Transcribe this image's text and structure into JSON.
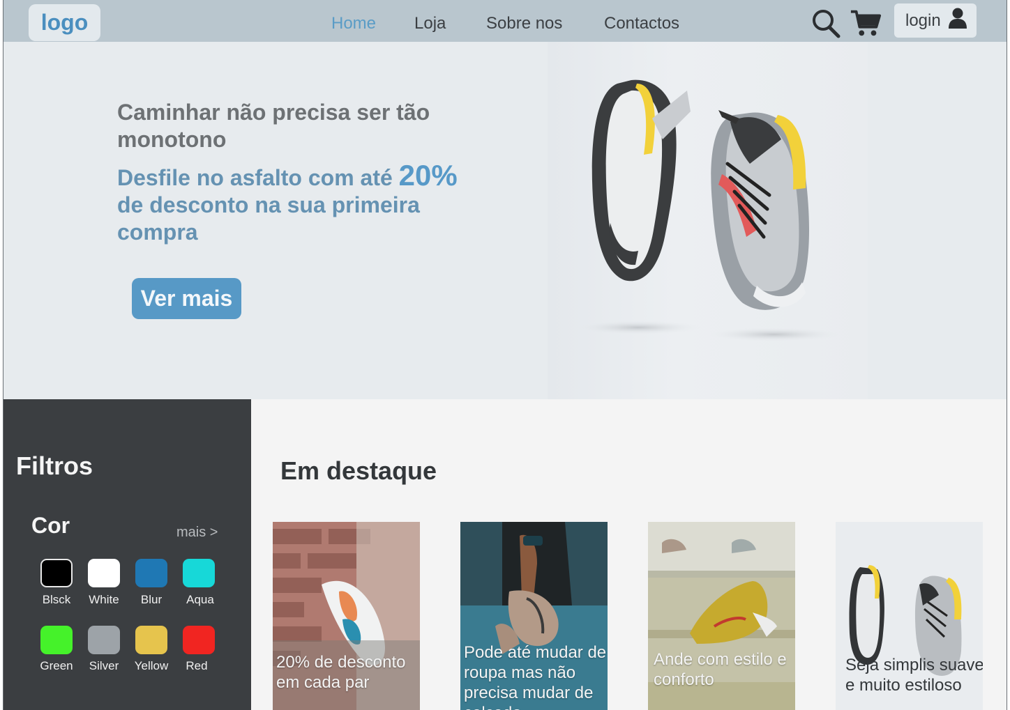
{
  "header": {
    "logo": "logo",
    "nav": [
      {
        "label": "Home",
        "active": true
      },
      {
        "label": "Loja",
        "active": false
      },
      {
        "label": "Sobre nos",
        "active": false
      },
      {
        "label": "Contactos",
        "active": false
      }
    ],
    "icons": [
      "search-icon",
      "cart-icon",
      "user-icon"
    ],
    "login_label": "login"
  },
  "hero": {
    "title": "Caminhar não precisa ser tão monotono",
    "promo_before": "Desfile no asfalto com até",
    "promo_highlight": "20%",
    "promo_after": "de desconto na sua primeira compra",
    "cta_label": "Ver mais"
  },
  "sidebar": {
    "title": "Filtros",
    "color_section": {
      "title": "Cor",
      "more_label": "mais >",
      "swatches": [
        {
          "label": "Blsck",
          "color": "#000000"
        },
        {
          "label": "White",
          "color": "#ffffff"
        },
        {
          "label": "Blur",
          "color": "#1f78b4"
        },
        {
          "label": "Aqua",
          "color": "#17d8d8"
        },
        {
          "label": "Green",
          "color": "#45f22a"
        },
        {
          "label": "Silver",
          "color": "#9da3a8"
        },
        {
          "label": "Yellow",
          "color": "#e6c44d"
        },
        {
          "label": "Red",
          "color": "#f12521"
        }
      ]
    }
  },
  "featured": {
    "title": "Em destaque",
    "cards": [
      {
        "caption": "20% de desconto em cada par"
      },
      {
        "caption": "Pode até mudar de roupa mas não precisa mudar de calçado"
      },
      {
        "caption": "Ande com estilo e conforto"
      },
      {
        "caption": "Seja simplis suave e muito estiloso"
      }
    ]
  },
  "colors": {
    "header_bg": "#b9c6ce",
    "accent": "#5799c6",
    "sidebar_bg": "#3b3e41"
  }
}
